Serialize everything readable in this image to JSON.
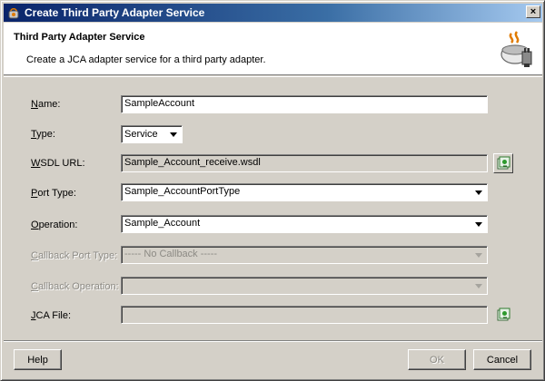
{
  "window": {
    "title": "Create Third Party Adapter Service",
    "close_label": "×"
  },
  "header": {
    "title": "Third Party Adapter Service",
    "description": "Create a JCA adapter service for a third party adapter."
  },
  "form": {
    "name": {
      "label_key": "N",
      "label_rest": "ame:",
      "value": "SampleAccount"
    },
    "type": {
      "label_key": "T",
      "label_rest": "ype:",
      "value": "Service"
    },
    "wsdl_url": {
      "label_key": "W",
      "label_rest": "SDL URL:",
      "value": "Sample_Account_receive.wsdl"
    },
    "port_type": {
      "label_key": "P",
      "label_rest": "ort Type:",
      "value": "Sample_AccountPortType"
    },
    "operation": {
      "label_key": "O",
      "label_rest": "peration:",
      "value": "Sample_Account"
    },
    "callback_port_type": {
      "label_key": "C",
      "label_rest": "allback Port Type:",
      "value": "----- No Callback -----"
    },
    "callback_operation": {
      "label_key": "C",
      "label_rest": "allback Operation:",
      "value": ""
    },
    "jca_file": {
      "label_key": "J",
      "label_rest": "CA File:",
      "value": ""
    }
  },
  "buttons": {
    "help": "Help",
    "ok": "OK",
    "cancel": "Cancel"
  },
  "icons": {
    "title": "adapter-icon",
    "header": "adapter-plug-icon",
    "browse": "browse-icon"
  },
  "colors": {
    "titlebar_start": "#0a246a",
    "titlebar_end": "#a6caf0",
    "dialog_bg": "#d4d0c8"
  }
}
